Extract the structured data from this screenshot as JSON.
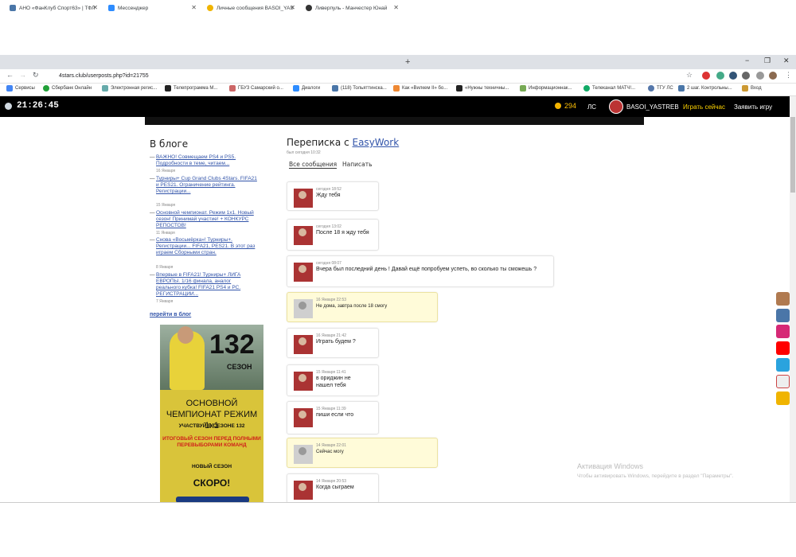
{
  "browser": {
    "tabs": [
      {
        "label": "АНО «ФанКлуб Спорт63» | ТФЛ",
        "active": false
      },
      {
        "label": "Мессенджер",
        "active": false
      },
      {
        "label": "Личные сообщения BASOI_YAS",
        "active": true
      },
      {
        "label": "Ливерпуль - Манчестер Юнай",
        "active": false
      }
    ],
    "url": "4stars.club/userposts.php?id=21755",
    "bookmarks": [
      "Сервисы",
      "Сбербанк Онлайн",
      "Электронная регис...",
      "Телепрограмма М...",
      "ГБУЗ Самарский о...",
      "Диалоги",
      "(118) Тольяттинска...",
      "Как «Вилкем II» бо...",
      "«Нужны техничны...",
      "Информационнак...",
      "Телеканал МАТЧ!...",
      "ТГУ ЛС",
      "2 шаг. Контрольны...",
      "Вход"
    ]
  },
  "header": {
    "clock": "21:26:45",
    "coins": "294",
    "ls_label": "ЛС",
    "username": "BASOI_YASTREB",
    "play_now": "Играть сейчас",
    "claim_game": "Заявить игру"
  },
  "blog": {
    "title": "В блоге",
    "items": [
      {
        "text": "ВАЖНО! Совмещаем PS4 и PS5. Подробности в теме, читаем...",
        "date": "16 Января"
      },
      {
        "text": "Турниры+ Cup Grand Clubs 4Stars. FIFA21 и PES21. Ограничение рейтинга. Регистрации...",
        "date": "15 Января"
      },
      {
        "text": "Основной чемпионат. Режим 1х1. Новый сезон! Принимай участие! + КОНКУРС РЕПОСТОВ!",
        "date": "11 Января"
      },
      {
        "text": "Снова «Восьмёрка»! Турниры+. Регистрации... FIFA21, PES21. В этот раз играем Сборными стран.",
        "date": "8 Января"
      },
      {
        "text": "Впервые в FIFA21! Турниры+ ЛИГА ЕВРОПЫ. 1/16 финала, аналог реального кубка! FIFA21 PS4 и PC. РЕГИСТРАЦИИ...",
        "date": "7 Января"
      }
    ],
    "to_blog": "перейти в блог"
  },
  "banner": {
    "number": "132",
    "season_label": "СЕЗОН",
    "headline": "ОСНОВНОЙ ЧЕМПИОНАТ РЕЖИМ 1х1",
    "participate": "УЧАСТВУЙ В СЕЗОНЕ 132",
    "final_season": "ИТОГОВЫЙ СЕЗОН ПЕРЕД ПОЛНЫМИ ПЕРЕВЫБОРАМИ КОМАНД",
    "new_season": "НОВЫЙ СЕЗОН",
    "soon": "СКОРО!"
  },
  "conversation": {
    "title_prefix": "Переписка с",
    "partner": "EasyWork",
    "last_seen": "был сегодня 10:32",
    "tab_all": "Все сообщения",
    "tab_write": "Написать",
    "messages": [
      {
        "date": "сегодня 18:52",
        "text": "Жду тебя",
        "own": false
      },
      {
        "date": "сегодня 13:02",
        "text": "После 18 я жду тебя",
        "own": false
      },
      {
        "date": "сегодня 08:07",
        "text": "Вчера был последний день ! Давай ещё попробуем успеть, во сколько ты сможешь ?",
        "own": false
      },
      {
        "date": "16 Января 22:53",
        "text": "Не дома, завтра после 18 смогу",
        "own": true
      },
      {
        "date": "16 Января 21:42",
        "text": "Играть будем ?",
        "own": false
      },
      {
        "date": "15 Января 11:41",
        "text": "в ориджин не нашел тебя",
        "own": false
      },
      {
        "date": "15 Января 11:39",
        "text": "пиши если что",
        "own": false
      },
      {
        "date": "14 Января 22:01",
        "text": "Сейчас могу",
        "own": true
      },
      {
        "date": "14 Января 20:53",
        "text": "Когда сыграем",
        "own": false
      }
    ]
  },
  "watermark": {
    "line1": "Активация Windows",
    "line2": "Чтобы активировать Windows, перейдите в раздел \"Параметры\"."
  },
  "colors": {
    "header_bg": "#000000",
    "accent_yellow": "#ffd400",
    "link_blue": "#3355aa",
    "own_message_bg": "#fffbd9",
    "banner_bg": "#d9c43a"
  }
}
